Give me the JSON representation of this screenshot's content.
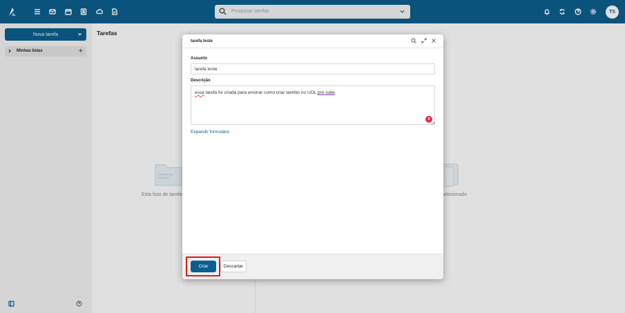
{
  "topbar": {
    "search_placeholder": "Pesquisar tarefas",
    "avatar_initials": "TS",
    "icons": [
      "menu-icon",
      "mail-icon",
      "calendar-icon",
      "contacts-icon",
      "cloud-icon",
      "tasks-icon",
      "bell-icon",
      "sync-icon",
      "help-icon",
      "gear-icon"
    ]
  },
  "sidebar": {
    "new_task_label": "Nova tarefa",
    "my_lists_label": "Minhas listas",
    "add_symbol": "+"
  },
  "main": {
    "title": "Tarefas",
    "empty_left_text": "Esta lista de tarefas",
    "empty_right_text": "o selecionado"
  },
  "modal": {
    "title": "tarefa teste",
    "subject_label": "Assunto",
    "subject_value": "tarefa teste",
    "description_label": "Descrição",
    "description_value": {
      "w1": "essa",
      "mid": " tarefa foi criada para ensinar como criar tarefas no UOL ",
      "w2": "pro suite",
      "end": "."
    },
    "grammar_count": "3",
    "expand_link": "Expandir formulário",
    "create_button": "Criar",
    "discard_button": "Descartar"
  },
  "colors": {
    "brand": "#0b5f8f",
    "highlight": "#e01b1b",
    "grammar_badge": "#d9304e"
  }
}
